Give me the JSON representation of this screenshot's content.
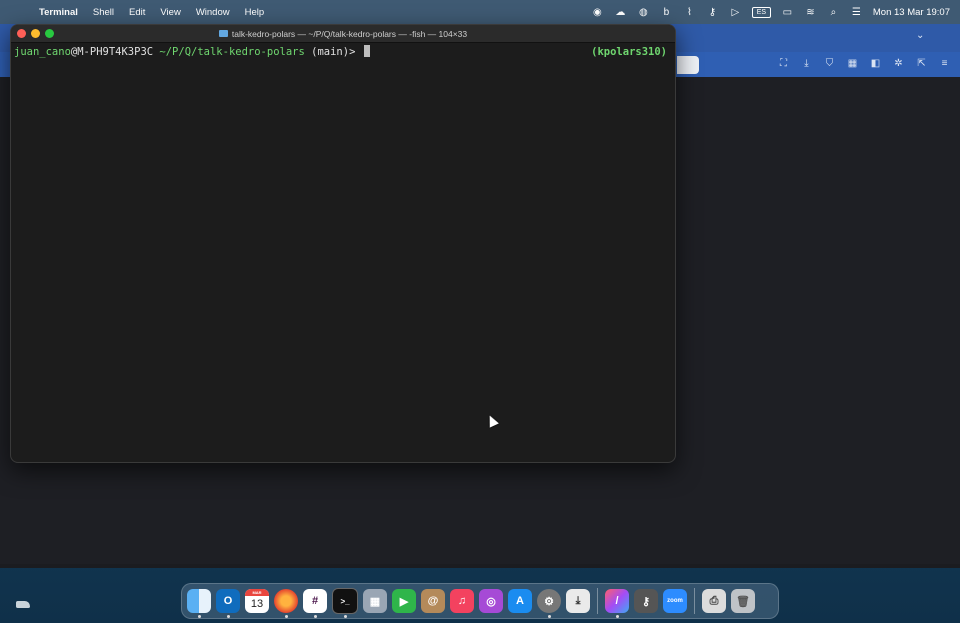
{
  "menubar": {
    "app_name": "Terminal",
    "menus": [
      "Shell",
      "Edit",
      "View",
      "Window",
      "Help"
    ],
    "keyboard_layout": "ES",
    "clock": "Mon 13 Mar  19:07"
  },
  "terminal": {
    "title": "talk-kedro-polars — ~/P/Q/talk-kedro-polars — -fish — 104×33",
    "prompt": {
      "user": "juan_cano",
      "at": "@",
      "host": "M-PH9T4K3P3C",
      "path": " ~/P/Q/talk-kedro-polars",
      "branch": " (main)> "
    },
    "right_prompt": "(kpolars310)"
  },
  "dock": {
    "calendar": {
      "month": "MAR",
      "day": "13"
    },
    "zoom_label": "zoom",
    "apps": [
      "finder-icon",
      "outlook-icon",
      "calendar-icon",
      "firefox-icon",
      "slack-icon",
      "terminal-icon",
      "launchpad-icon",
      "facetime-icon",
      "contacts-icon",
      "music-icon",
      "podcasts-icon",
      "appstore-icon",
      "system-settings-icon",
      "downloads-icon",
      "pencil-app-icon",
      "keychain-icon",
      "zoom-icon",
      "printer-icon",
      "trash-icon"
    ]
  },
  "colors": {
    "menubar": "#3f5a73",
    "terminal_bg": "#1c1c1c",
    "prompt_green": "#6fd66f",
    "browser_blue": "#2f5fb3"
  }
}
